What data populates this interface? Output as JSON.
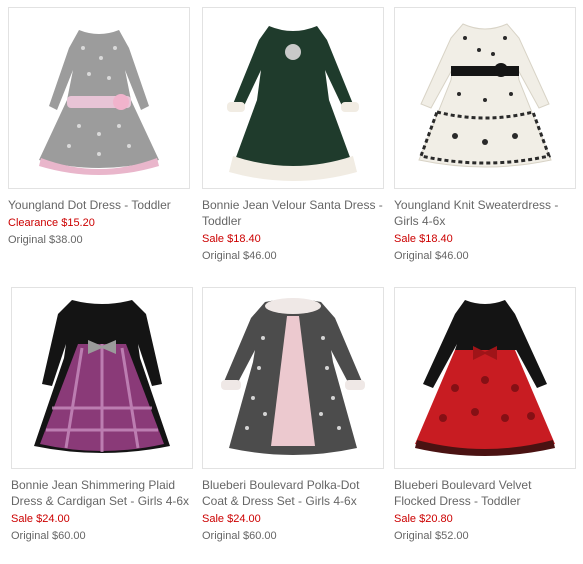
{
  "products": [
    {
      "title": "Youngland Dot Dress - Toddler",
      "sale_label": "Clearance",
      "sale_price": "$15.20",
      "orig_label": "Original",
      "orig_price": "$38.00"
    },
    {
      "title": "Bonnie Jean Velour Santa Dress - Toddler",
      "sale_label": "Sale",
      "sale_price": "$18.40",
      "orig_label": "Original",
      "orig_price": "$46.00"
    },
    {
      "title": "Youngland Knit Sweaterdress - Girls 4-6x",
      "sale_label": "Sale",
      "sale_price": "$18.40",
      "orig_label": "Original",
      "orig_price": "$46.00"
    },
    {
      "title": "Bonnie Jean Shimmering Plaid Dress & Cardigan Set - Girls 4-6x",
      "sale_label": "Sale",
      "sale_price": "$24.00",
      "orig_label": "Original",
      "orig_price": "$60.00"
    },
    {
      "title": "Blueberi Boulevard Polka-Dot Coat & Dress Set - Girls 4-6x",
      "sale_label": "Sale",
      "sale_price": "$24.00",
      "orig_label": "Original",
      "orig_price": "$60.00"
    },
    {
      "title": "Blueberi Boulevard Velvet Flocked Dress - Toddler",
      "sale_label": "Sale",
      "sale_price": "$20.80",
      "orig_label": "Original",
      "orig_price": "$52.00"
    }
  ],
  "colors": {
    "sale": "#cc0000",
    "text": "#666666",
    "border": "#e2e2e2"
  }
}
